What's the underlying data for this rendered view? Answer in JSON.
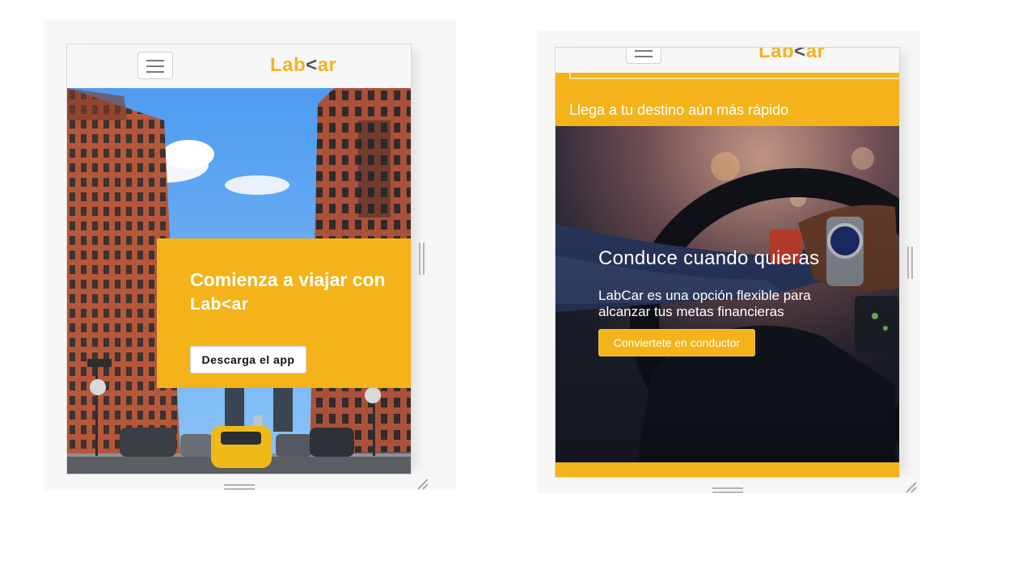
{
  "left_phone": {
    "logo": {
      "prefix": "Lab",
      "arrow": "<",
      "suffix": "ar"
    },
    "menu_icon": "hamburger-icon",
    "hero": {
      "title": "Comienza a viajar con",
      "logo_text": "Lab<ar",
      "cta": "Descarga el app"
    }
  },
  "right_phone": {
    "logo": {
      "prefix": "Lab",
      "arrow": "<",
      "suffix": "ar"
    },
    "menu_icon": "hamburger-icon",
    "band_text": "Llega a tu destino aún más rápido",
    "hero": {
      "title": "Conduce cuando quieras",
      "subtitle": "LabCar es una opción flexible para alcanzar tus metas financieras",
      "cta": "Conviertete en conductor"
    }
  },
  "colors": {
    "brand_yellow": "#f4b31b",
    "header_bg": "#f7f7f7"
  }
}
